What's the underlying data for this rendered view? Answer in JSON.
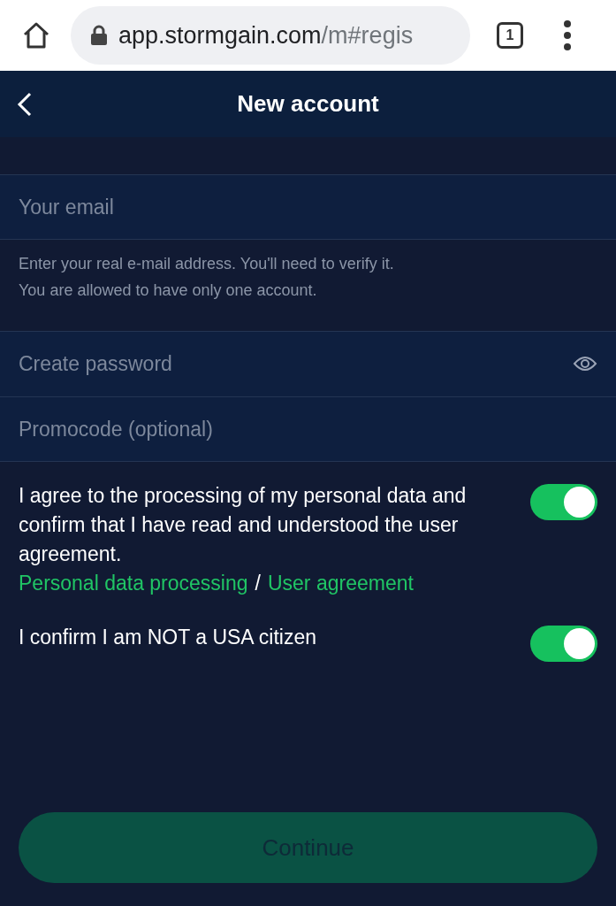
{
  "browser": {
    "url_host": "app.stormgain.com",
    "url_path": "/m#regis",
    "tab_count": "1"
  },
  "header": {
    "title": "New account"
  },
  "fields": [
    {
      "kind": "email",
      "placeholder": "Your email",
      "hint": [
        "Enter your real e-mail address. You'll need to verify it.",
        "You are allowed to have only one account."
      ]
    },
    {
      "kind": "password",
      "placeholder": "Create password"
    },
    {
      "kind": "text",
      "placeholder": "Promocode (optional)"
    }
  ],
  "consents": [
    {
      "text": "I agree to the processing of my personal data and confirm that I have read and understood the user agreement.",
      "links": [
        "Personal data processing",
        "User agreement"
      ],
      "separator": "/",
      "on": true
    },
    {
      "text": "I confirm I am NOT a USA citizen",
      "on": true
    }
  ],
  "continue_button": {
    "label": "Continue",
    "disabled": true
  }
}
